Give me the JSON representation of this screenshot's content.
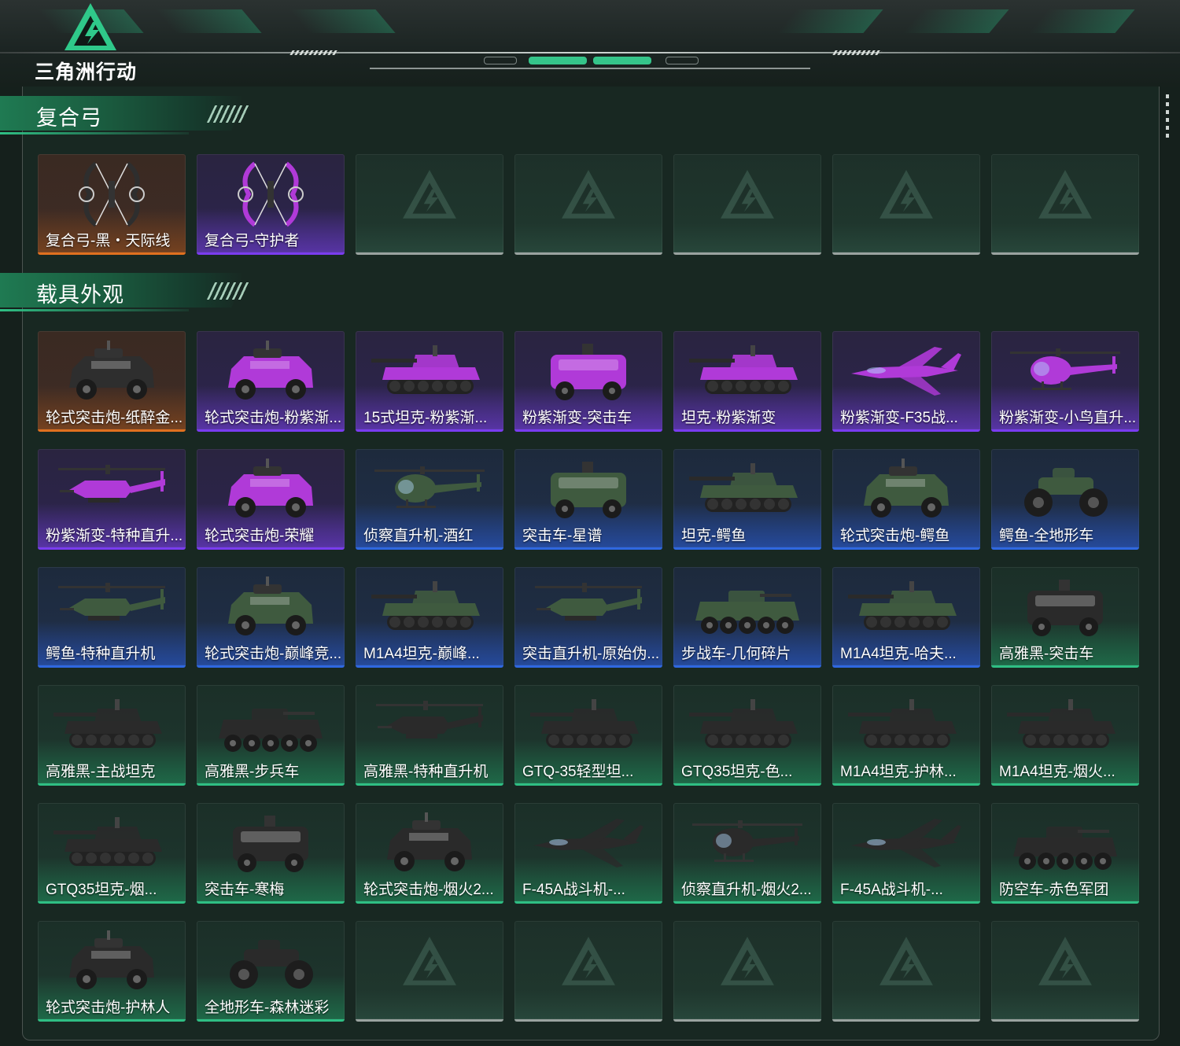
{
  "app": {
    "logo_text": "三角洲行动"
  },
  "colors": {
    "gold": "#e0701f",
    "purple": "#7a3cf0",
    "blue": "#2f68e0",
    "green": "#2fbf84",
    "empty": "#9aa3a0"
  },
  "sections": [
    {
      "title": "复合弓",
      "items": [
        {
          "name": "复合弓-黑・天际线",
          "rarity": "gold",
          "icon": "compound-bow-icon"
        },
        {
          "name": "复合弓-守护者",
          "rarity": "purple",
          "icon": "compound-bow-icon"
        },
        {
          "empty": true
        },
        {
          "empty": true
        },
        {
          "empty": true
        },
        {
          "empty": true
        },
        {
          "empty": true
        }
      ]
    },
    {
      "title": "载具外观",
      "items": [
        {
          "name": "轮式突击炮-纸醉金...",
          "rarity": "gold",
          "icon": "armored-car-icon"
        },
        {
          "name": "轮式突击炮-粉紫渐...",
          "rarity": "purple",
          "icon": "armored-car-icon"
        },
        {
          "name": "15式坦克-粉紫渐...",
          "rarity": "purple",
          "icon": "tank-icon"
        },
        {
          "name": "粉紫渐变-突击车",
          "rarity": "purple",
          "icon": "assault-vehicle-icon"
        },
        {
          "name": "坦克-粉紫渐变",
          "rarity": "purple",
          "icon": "tank-icon"
        },
        {
          "name": "粉紫渐变-F35战...",
          "rarity": "purple",
          "icon": "jet-icon"
        },
        {
          "name": "粉紫渐变-小鸟直升...",
          "rarity": "purple",
          "icon": "helicopter-icon"
        },
        {
          "name": "粉紫渐变-特种直升...",
          "rarity": "purple",
          "icon": "attack-helicopter-icon"
        },
        {
          "name": "轮式突击炮-荣耀",
          "rarity": "purple",
          "icon": "armored-car-icon"
        },
        {
          "name": "侦察直升机-酒红",
          "rarity": "blue",
          "icon": "helicopter-icon"
        },
        {
          "name": "突击车-星谱",
          "rarity": "blue",
          "icon": "assault-vehicle-icon"
        },
        {
          "name": "坦克-鳄鱼",
          "rarity": "blue",
          "icon": "tank-icon"
        },
        {
          "name": "轮式突击炮-鳄鱼",
          "rarity": "blue",
          "icon": "armored-car-icon"
        },
        {
          "name": "鳄鱼-全地形车",
          "rarity": "blue",
          "icon": "atv-icon"
        },
        {
          "name": "鳄鱼-特种直升机",
          "rarity": "blue",
          "icon": "attack-helicopter-icon"
        },
        {
          "name": "轮式突击炮-巅峰竞...",
          "rarity": "blue",
          "icon": "armored-car-icon"
        },
        {
          "name": "M1A4坦克-巅峰...",
          "rarity": "blue",
          "icon": "tank-icon"
        },
        {
          "name": "突击直升机-原始伪...",
          "rarity": "blue",
          "icon": "attack-helicopter-icon"
        },
        {
          "name": "步战车-几何碎片",
          "rarity": "blue",
          "icon": "ifv-icon"
        },
        {
          "name": "M1A4坦克-哈夫...",
          "rarity": "blue",
          "icon": "tank-icon"
        },
        {
          "name": "高雅黑-突击车",
          "rarity": "green",
          "icon": "assault-vehicle-icon"
        },
        {
          "name": "高雅黑-主战坦克",
          "rarity": "green",
          "icon": "tank-icon"
        },
        {
          "name": "高雅黑-步兵车",
          "rarity": "green",
          "icon": "ifv-icon"
        },
        {
          "name": "高雅黑-特种直升机",
          "rarity": "green",
          "icon": "attack-helicopter-icon"
        },
        {
          "name": "GTQ-35轻型坦...",
          "rarity": "green",
          "icon": "tank-icon"
        },
        {
          "name": "GTQ35坦克-色...",
          "rarity": "green",
          "icon": "tank-icon"
        },
        {
          "name": "M1A4坦克-护林...",
          "rarity": "green",
          "icon": "tank-icon"
        },
        {
          "name": "M1A4坦克-烟火...",
          "rarity": "green",
          "icon": "tank-icon"
        },
        {
          "name": "GTQ35坦克-烟...",
          "rarity": "green",
          "icon": "tank-icon"
        },
        {
          "name": "突击车-寒梅",
          "rarity": "green",
          "icon": "assault-vehicle-icon"
        },
        {
          "name": "轮式突击炮-烟火2...",
          "rarity": "green",
          "icon": "armored-car-icon"
        },
        {
          "name": "F-45A战斗机-...",
          "rarity": "green",
          "icon": "jet-icon"
        },
        {
          "name": "侦察直升机-烟火2...",
          "rarity": "green",
          "icon": "helicopter-icon"
        },
        {
          "name": "F-45A战斗机-...",
          "rarity": "green",
          "icon": "jet-icon"
        },
        {
          "name": "防空车-赤色军团",
          "rarity": "green",
          "icon": "ifv-icon"
        },
        {
          "name": "轮式突击炮-护林人",
          "rarity": "green",
          "icon": "armored-car-icon"
        },
        {
          "name": "全地形车-森林迷彩",
          "rarity": "green",
          "icon": "atv-icon"
        },
        {
          "empty": true
        },
        {
          "empty": true
        },
        {
          "empty": true
        },
        {
          "empty": true
        },
        {
          "empty": true
        }
      ]
    }
  ]
}
